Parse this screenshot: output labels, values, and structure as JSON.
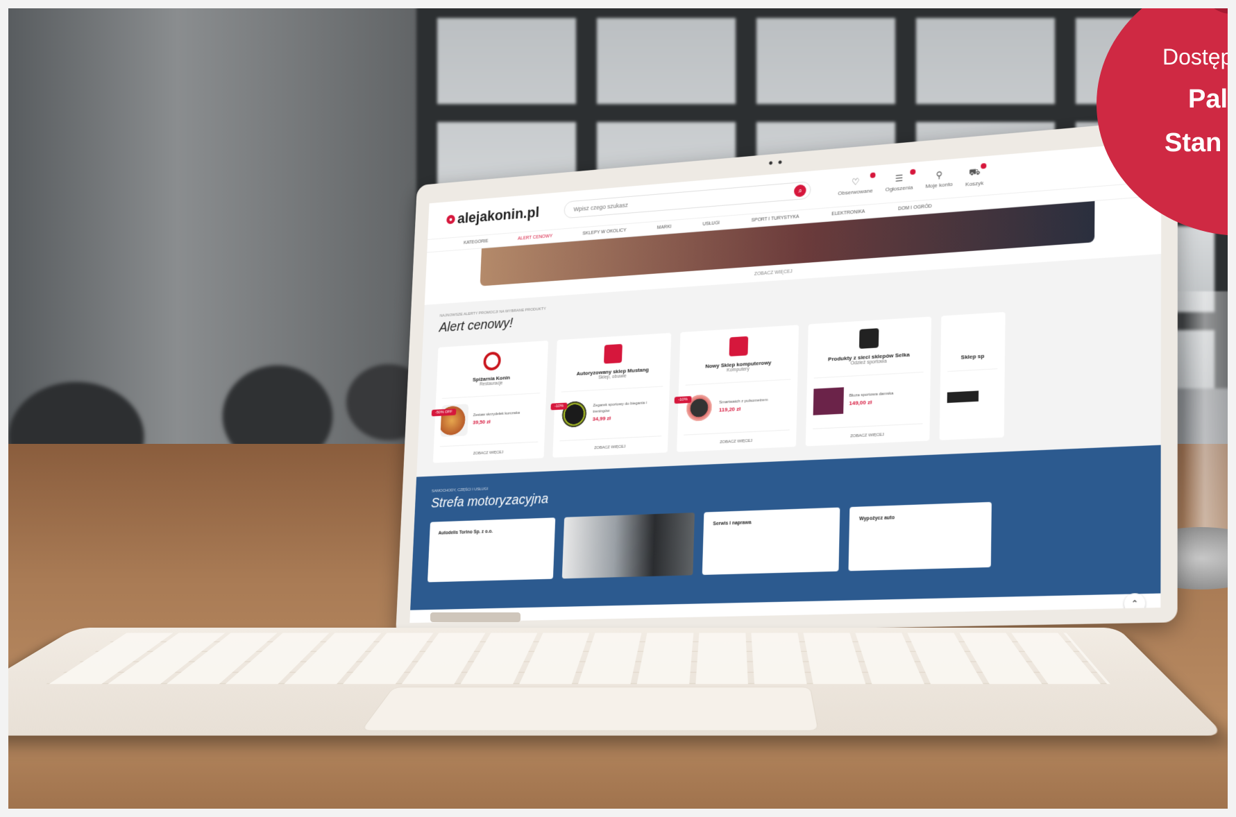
{
  "promo": {
    "line1": "Dostęp",
    "line2": "Pal",
    "line3": "Stan"
  },
  "site": {
    "logo": "alejakonin.pl",
    "search_placeholder": "Wpisz czego szukasz",
    "header_icons": [
      {
        "icon": "heart-icon",
        "label": "Obserwowane"
      },
      {
        "icon": "list-icon",
        "label": "Ogłoszenia"
      },
      {
        "icon": "user-icon",
        "label": "Moje konto"
      },
      {
        "icon": "cart-icon",
        "label": "Koszyk"
      }
    ],
    "nav": [
      "KATEGORIE",
      "ALERT CENOWY",
      "SKLEPY W OKOLICY",
      "MARKI",
      "USŁUGI",
      "SPORT I TURYSTYKA",
      "ELEKTRONIKA",
      "DOM I OGRÓD"
    ],
    "strip_link": "ZOBACZ WIĘCEJ",
    "alert": {
      "kicker": "NAJNOWSZE ALERTY PROMOCJI NA WYBRANE PRODUKTY",
      "title": "Alert cenowy!",
      "cards": [
        {
          "name": "Spiżarnia Konin",
          "sub": "Restauracje",
          "sale": "-50% OFF",
          "prod": "Zestaw skrzydełek kurczaka",
          "price": "39,50 zł",
          "link": "ZOBACZ WIĘCEJ"
        },
        {
          "name": "Autoryzowany sklep Mustang",
          "sub": "Sklep, obuwie",
          "sale": "-10%",
          "prod": "Zegarek sportowy do biegania i treningów",
          "price": "34,99 zł",
          "link": "ZOBACZ WIĘCEJ"
        },
        {
          "name": "Nowy Sklep komputerowy",
          "sub": "Komputery",
          "sale": "-10%",
          "prod": "Smartwatch z pulsometrem",
          "price": "119,20 zł",
          "link": "ZOBACZ WIĘCEJ"
        },
        {
          "name": "Produkty z sieci sklepów Selka",
          "sub": "Odzież sportowa",
          "sale": "",
          "prod": "Bluza sportowa damska",
          "price": "149,00 zł",
          "link": "ZOBACZ WIĘCEJ"
        },
        {
          "name": "Sklep sp",
          "sub": "",
          "sale": "",
          "prod": "",
          "price": "",
          "link": ""
        }
      ]
    },
    "moto": {
      "kicker": "SAMOCHODY, CZĘŚCI I USŁUGI",
      "title": "Strefa motoryzacyjna",
      "cards": [
        "Autodelis Torino Sp. z o.o.",
        "Serwis i naprawa",
        "Wypożycz auto"
      ]
    }
  }
}
